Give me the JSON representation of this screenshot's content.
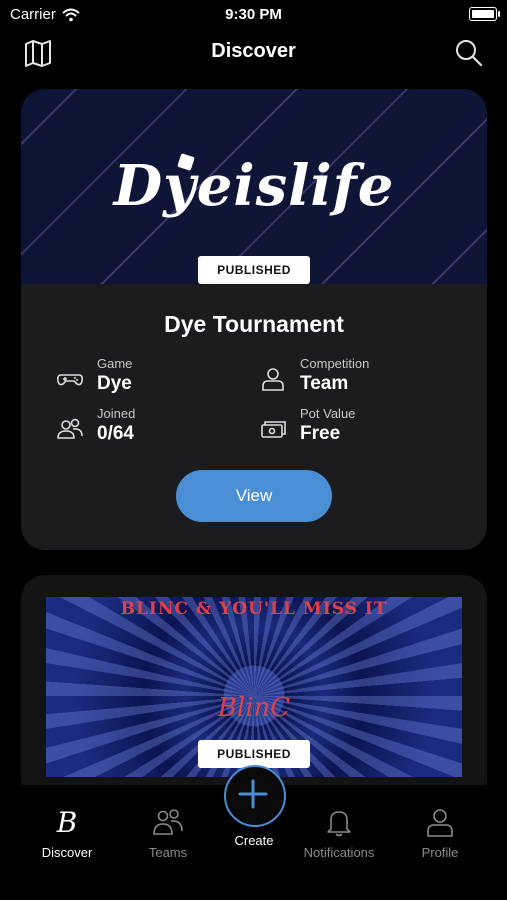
{
  "status_bar": {
    "carrier": "Carrier",
    "time": "9:30 PM"
  },
  "header": {
    "title": "Discover"
  },
  "cards": [
    {
      "banner_logo": "Dyeislife",
      "badge": "PUBLISHED",
      "title": "Dye Tournament",
      "info": {
        "game_label": "Game",
        "game_value": "Dye",
        "competition_label": "Competition",
        "competition_value": "Team",
        "joined_label": "Joined",
        "joined_value": "0/64",
        "pot_label": "Pot Value",
        "pot_value": "Free"
      },
      "button": "View"
    },
    {
      "banner_title": "BLINC & YOU'LL MISS IT",
      "banner_logo": "BlinC",
      "badge": "PUBLISHED"
    }
  ],
  "tabbar": {
    "discover": "Discover",
    "teams": "Teams",
    "create": "Create",
    "notifications": "Notifications",
    "profile": "Profile"
  },
  "colors": {
    "accent": "#4a8fd6",
    "card_bg": "#1c1c1e",
    "banner_bg": "#0f1537"
  }
}
